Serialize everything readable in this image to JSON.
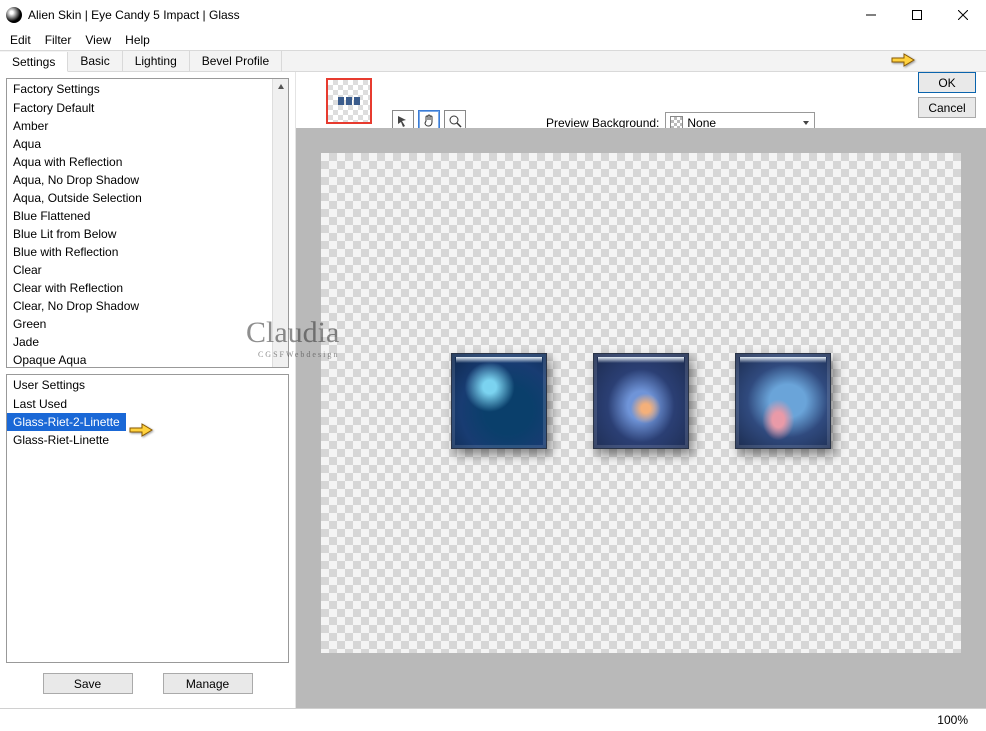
{
  "window": {
    "title": "Alien Skin | Eye Candy 5 Impact | Glass"
  },
  "menu": {
    "edit": "Edit",
    "filter": "Filter",
    "view": "View",
    "help": "Help"
  },
  "tabs": {
    "settings": "Settings",
    "basic": "Basic",
    "lighting": "Lighting",
    "bevel": "Bevel Profile"
  },
  "factory": {
    "header": "Factory Settings",
    "items": [
      "Factory Default",
      "Amber",
      "Aqua",
      "Aqua with Reflection",
      "Aqua, No Drop Shadow",
      "Aqua, Outside Selection",
      "Blue Flattened",
      "Blue Lit from Below",
      "Blue with Reflection",
      "Clear",
      "Clear with Reflection",
      "Clear, No Drop Shadow",
      "Green",
      "Jade",
      "Opaque Aqua"
    ]
  },
  "user": {
    "header": "User Settings",
    "items": [
      "Last Used",
      "Glass-Riet-2-Linette",
      "Glass-Riet-Linette"
    ],
    "selected_index": 1
  },
  "buttons": {
    "save": "Save",
    "manage": "Manage",
    "ok": "OK",
    "cancel": "Cancel"
  },
  "preview": {
    "label": "Preview Background:",
    "value": "None"
  },
  "status": {
    "zoom": "100%"
  },
  "watermark": {
    "name": "Claudia",
    "sub": "CGSFWebdesign"
  }
}
